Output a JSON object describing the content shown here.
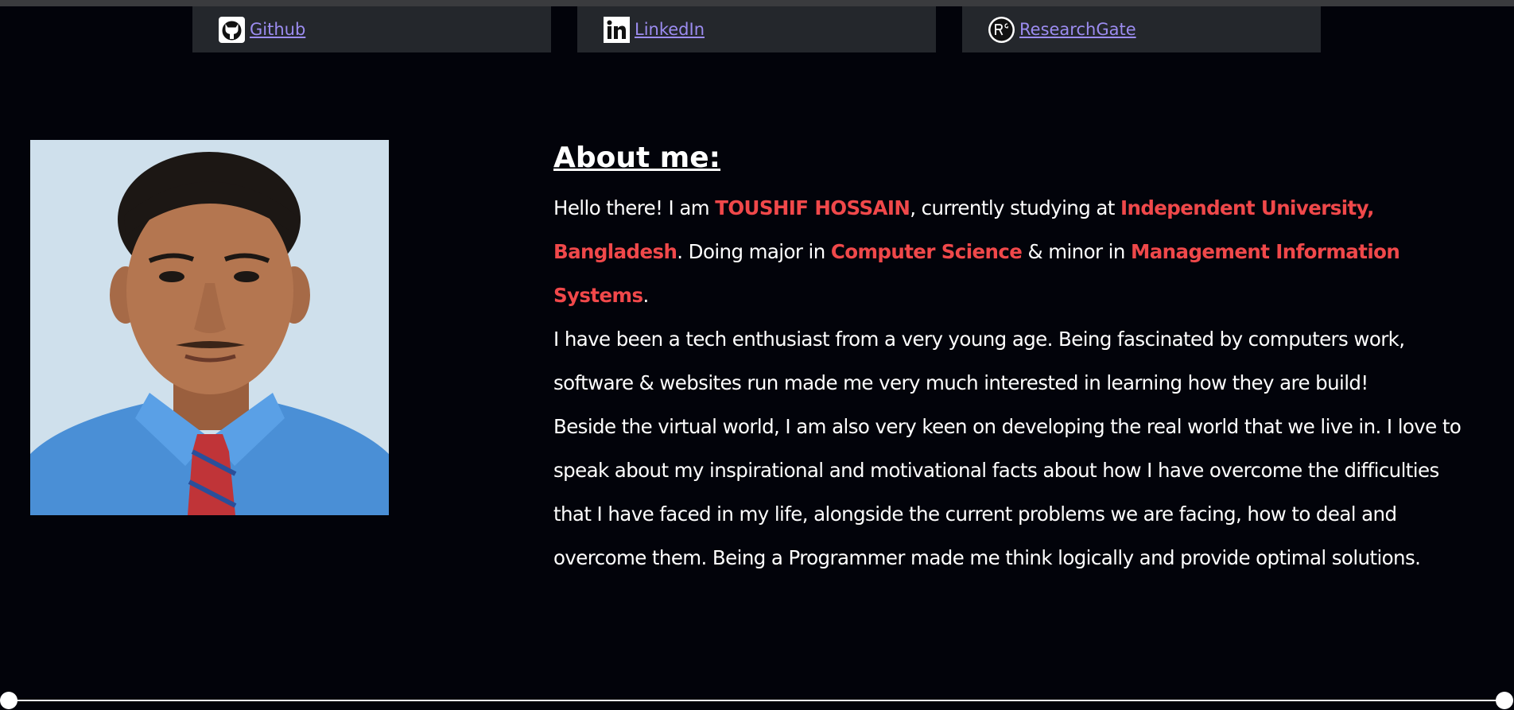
{
  "links": [
    {
      "label": "Github",
      "icon": "github-icon"
    },
    {
      "label": "LinkedIn",
      "icon": "linkedin-icon"
    },
    {
      "label": "ResearchGate",
      "icon": "researchgate-icon"
    }
  ],
  "about": {
    "heading": "About me:",
    "intro": {
      "t1": "Hello there! I am ",
      "name": "TOUSHIF HOSSAIN",
      "t2": ", currently studying at ",
      "university": "Independent University, Bangladesh",
      "t3": ". Doing major in ",
      "major": "Computer Science",
      "t4": " & minor in ",
      "minor": "Management Information Systems",
      "t5": "."
    },
    "paragraph2": "I have been a tech enthusiast from a very young age. Being fascinated by computers work, software & websites run made me very much interested in learning how they are build!",
    "paragraph3": "Beside the virtual world, I am also very keen on developing the real world that we live in. I love to speak about my inspirational and motivational facts about how I have overcome the difficulties that I have faced in my life, alongside the current problems we are facing, how to deal and overcome them. Being a Programmer made me think logically and provide optimal solutions."
  },
  "colors": {
    "background": "#02030a",
    "card": "#24272c",
    "link": "#9c8cf0",
    "highlight": "#f0484a",
    "text": "#ffffff"
  }
}
